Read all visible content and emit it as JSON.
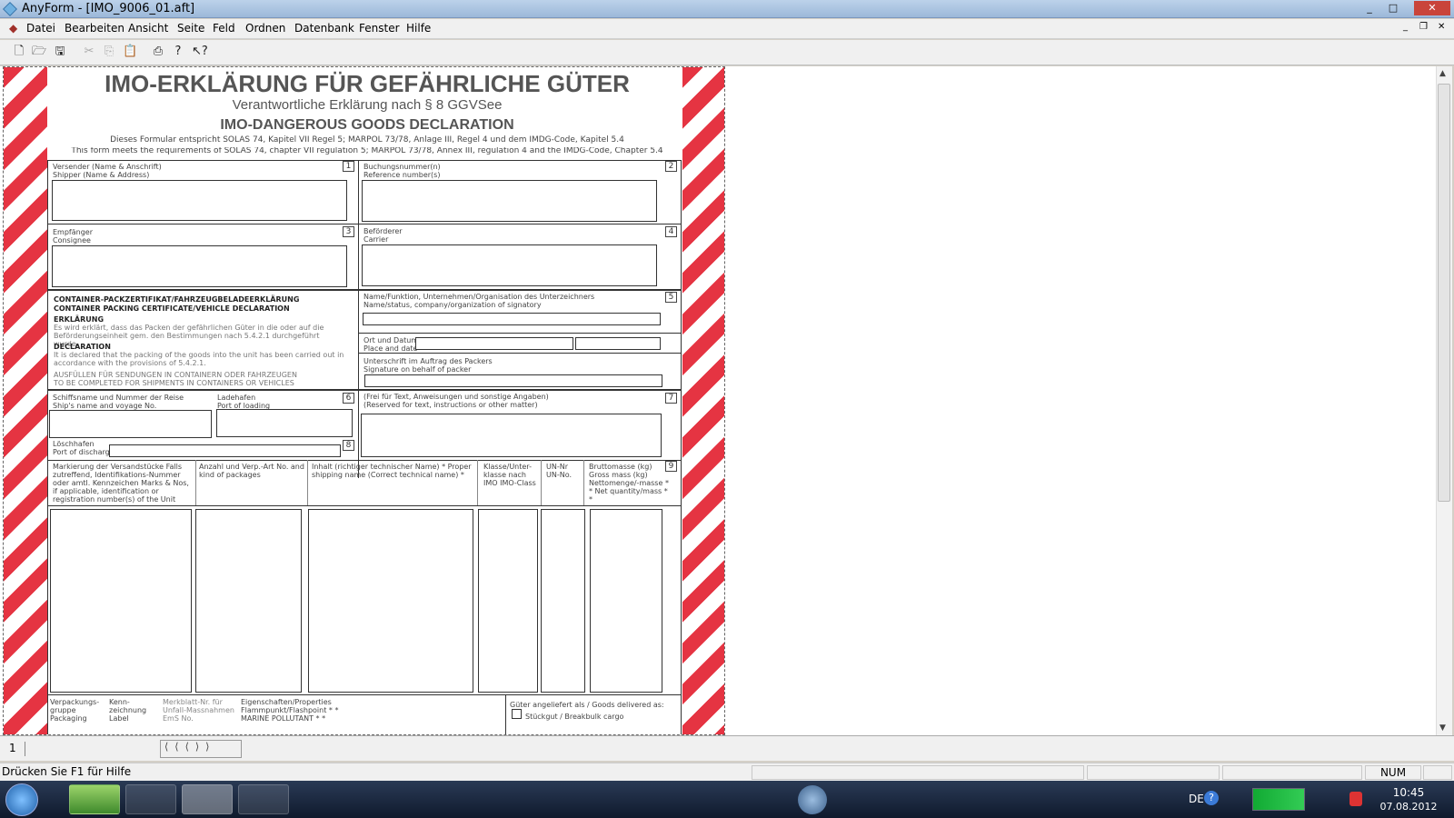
{
  "window": {
    "title": "AnyForm - [IMO_9006_01.aft]"
  },
  "menu": [
    "Datei",
    "Bearbeiten",
    "Ansicht",
    "Seite",
    "Feld",
    "Ordnen",
    "Datenbank",
    "Fenster",
    "Hilfe"
  ],
  "toolbar": {
    "icons": [
      "new-icon",
      "open-icon",
      "save-icon",
      "cut-icon",
      "copy-icon",
      "paste-icon",
      "print-icon",
      "help-icon",
      "context-help-icon"
    ]
  },
  "form": {
    "title": "IMO-ERKLÄRUNG FÜR GEFÄHRLICHE GÜTER",
    "subtitle": "Verantwortliche Erklärung nach § 8 GGVSee",
    "subtitle_en": "IMO-DANGEROUS GOODS DECLARATION",
    "note_de": "Dieses Formular entspricht SOLAS 74, Kapitel VII Regel 5; MARPOL 73/78, Anlage III, Regel 4 und dem IMDG-Code, Kapitel 5.4",
    "note_en": "This form meets the requirements of SOLAS 74, chapter VII regulation 5; MARPOL 73/78, Annex III, regulation 4 and the IMDG-Code, Chapter 5.4",
    "f1": "Versender (Name & Anschrift)",
    "f1e": "Shipper (Name & Address)",
    "n1": "1",
    "f2": "Buchungsnummer(n)",
    "f2e": "Reference number(s)",
    "n2": "2",
    "f3": "Empfänger",
    "f3e": "Consignee",
    "n3": "3",
    "f4": "Beförderer",
    "f4e": "Carrier",
    "n4": "4",
    "cp_title": "CONTAINER-PACKZERTIFIKAT/FAHRZEUGBELADEERKLÄRUNG",
    "cp_title_en": "CONTAINER PACKING CERTIFICATE/VEHICLE DECLARATION",
    "erk": "ERKLÄRUNG",
    "erk_text": "Es wird erklärt, dass das Packen der gefährlichen Güter in die oder auf die Beförderungseinheit gem. den Bestimmungen nach 5.4.2.1 durchgeführt wurde.",
    "decl": "DECLARATION",
    "decl_text": "It is declared that the packing of the goods into the unit has been carried out in accordance with the provisions of 5.4.2.1.",
    "fill": "AUSFÜLLEN FÜR SENDUNGEN IN CONTAINERN ODER FAHRZEUGEN",
    "fill_en": "TO BE COMPLETED FOR SHIPMENTS IN CONTAINERS OR VEHICLES",
    "f5": "Name/Funktion, Unternehmen/Organisation des Unterzeichners",
    "f5e": "Name/status, company/organization of signatory",
    "n5": "5",
    "place": "Ort und Datum",
    "place_e": "Place and date",
    "sig": "Unterschrift im Auftrag des Packers",
    "sig_e": "Signature on behalf of packer",
    "ship": "Schiffsname und Nummer der Reise",
    "ship_e": "Ship's name and voyage No.",
    "pol": "Ladehafen",
    "pol_e": "Port of loading",
    "n6": "6",
    "pod": "Löschhafen",
    "pod_e": "Port of discharge",
    "n8": "8",
    "f7": "(Frei für Text, Anweisungen und sonstige Angaben)",
    "f7e": "(Reserved for text, instructions or other matter)",
    "n7": "7",
    "c1": "Markierung der Versandstücke Falls zutreffend, Identifikations-Nummer oder amtl. Kennzeichen Marks & Nos, if applicable, identification or registration number(s) of the Unit",
    "c2": "Anzahl und Verp.-Art No. and kind of packages",
    "c3": "Inhalt (richtiger technischer Name) * Proper shipping name (Correct technical name) *",
    "c4": "Klasse/Unter-klasse nach IMO IMO-Class",
    "c5": "UN-Nr UN-No.",
    "c6": "Bruttomasse (kg) Gross mass (kg) Nettomenge/-masse * * Net quantity/mass * *",
    "n9": "9",
    "b1": "Verpackungs-gruppe Packaging",
    "b2": "Kenn-zeichnung Label",
    "b3": "Merkblatt-Nr. für Unfall-Massnahmen EmS No.",
    "b4": "Eigenschaften/Properties Flammpunkt/Flashpoint * * MARINE POLLUTANT * *",
    "b5": "Güter angeliefert als / Goods delivered as:",
    "b6": "Stückgut / Breakbulk cargo"
  },
  "pagebar": {
    "page": "1"
  },
  "status": {
    "hint": "Drücken Sie F1 für Hilfe",
    "num": "NUM"
  },
  "taskbar": {
    "lang": "DE",
    "time": "10:45",
    "date": "07.08.2012"
  },
  "colors": {
    "stripe": "#e53442"
  }
}
